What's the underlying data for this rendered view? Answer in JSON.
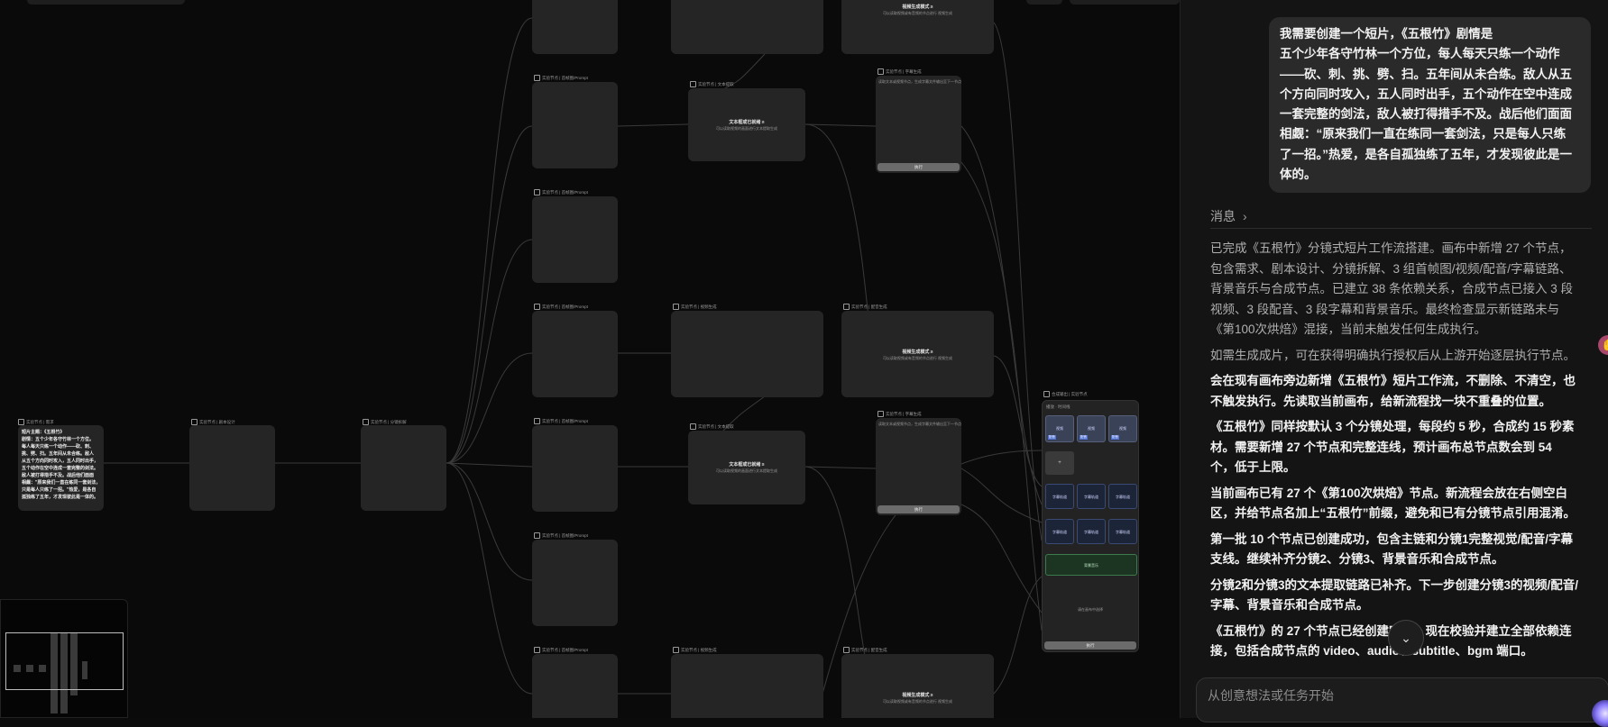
{
  "canvas": {
    "root_node": {
      "header": "实验节点 | 需求",
      "text_lines": [
        "短片主题：《五根竹》",
        "剧情：五个少年各守竹林一个方位。",
        "每人每天只练一个动作——砍、刺、",
        "挑、劈、扫。五年间从未合练。敌人",
        "从五个方向同时攻入，五人同时出手，",
        "五个动作在空中连成一套完整的剑法。",
        "敌人被打得措手不及。战后他们面面",
        "相觑：\"原来我们一直在练同一套剑法，",
        "只是每人只练了一招。\"热爱，是各自",
        "孤独练了五年，才发现彼此是一体的。"
      ]
    },
    "script_node_header": "实验节点 | 剧本设计",
    "split_node_header": "实验节点 | 分镜拆解",
    "prompt_header_a": "实验节点 | 首帧图/Prompt",
    "prompt_header_b": "实验节点 | 首帧图/Prompt",
    "video_header": "实验节点 | 视频生成",
    "audio_header": "实验节点 | 配音生成",
    "text_extract_header": "实验节点 | 文本提取",
    "subtitle_header": "实验节点 | 字幕生成",
    "text_extract_title": "文本框或已就绪 ≥",
    "text_extract_sub": "可以读取视频的画面进行文本提取生成",
    "video_title": "视频生成模式 ≥",
    "video_sub": "可以读取视频或有音频的节点进行 视频生成",
    "subtitle_desc": "读取文本或视频节点，生成字幕文件输出至下一节点",
    "run_label": "执行",
    "composite_header": "合成输出 | 实验节点",
    "composite_tabs": "播放 · 时间线",
    "composite_video_label": "视频",
    "composite_tag": "配音",
    "composite_tag2": "字幕 · 配音",
    "composite_add": "+",
    "composite_subtitle_label": "字幕轨道",
    "composite_bgm_label": "背景音乐",
    "composite_empty": "请在画布中选择",
    "composite_run": "执行"
  },
  "panel": {
    "user_message_lines": [
      "我需要创建一个短片，《五根竹》剧情是",
      "五个少年各守竹林一个方位，每人每天只练一个动作",
      "——砍、刺、挑、劈、扫。五年间从未合练。敌人从五",
      "个方向同时攻入，五人同时出手，五个动作在空中连成",
      "一套完整的剑法，敌人被打得措手不及。战后他们面面",
      "相觑：“原来我们一直在练同一套剑法，只是每人只练",
      "了一招。”热爱，是各自孤独练了五年，才发现彼此是一",
      "体的。"
    ],
    "messages_label": "消息",
    "paragraphs": [
      {
        "style": "dim",
        "lines": [
          "已完成《五根竹》分镜式短片工作流搭建。画布中新增 27 个节点，",
          "包含需求、剧本设计、分镜拆解、3 组首帧图/视频/配音/字幕链路、",
          "背景音乐与合成节点。已建立 38 条依赖关系，合成节点已接入 3 段",
          "视频、3 段配音、3 段字幕和背景音乐。最终检查显示新链路未与",
          "《第100次烘焙》混接，当前未触发任何生成执行。"
        ]
      },
      {
        "style": "dim",
        "lines": [
          "如需生成成片，可在获得明确执行授权后从上游开始逐层执行节点。"
        ]
      },
      {
        "style": "hi",
        "lines": [
          "会在现有画布旁边新增《五根竹》短片工作流，不删除、不清空，也",
          "不触发执行。先读取当前画布，给新流程找一块不重叠的位置。"
        ]
      },
      {
        "style": "hi",
        "lines": [
          "《五根竹》同样按默认 3 个分镜处理，每段约 5 秒，合成约 15 秒素",
          "材。需要新增 27 个节点和完整连线，预计画布总节点数会到 54",
          "个，低于上限。"
        ]
      },
      {
        "style": "hi",
        "lines": [
          "当前画布已有 27 个《第100次烘焙》节点。新流程会放在右侧空白",
          "区，并给节点名加上“五根竹”前缀，避免和已有分镜节点引用混淆。"
        ]
      },
      {
        "style": "hi",
        "lines": [
          "第一批 10 个节点已创建成功，包含主链和分镜1完整视觉/配音/字幕",
          "支线。继续补齐分镜2、分镜3、背景音乐和合成节点。"
        ]
      },
      {
        "style": "hi",
        "lines": [
          "分镜2和分镜3的文本提取链路已补齐。下一步创建分镜3的视频/配音/",
          "字幕、背景音乐和合成节点。"
        ]
      },
      {
        "style": "hi",
        "lines": [
          "《五根竹》的 27 个节点已经创建完成。现在校验并建立全部依赖连",
          "接，包括合成节点的 video、audio、subtitle、bgm 端口。"
        ]
      }
    ],
    "input_placeholder": "从创意想法或任务开始"
  }
}
